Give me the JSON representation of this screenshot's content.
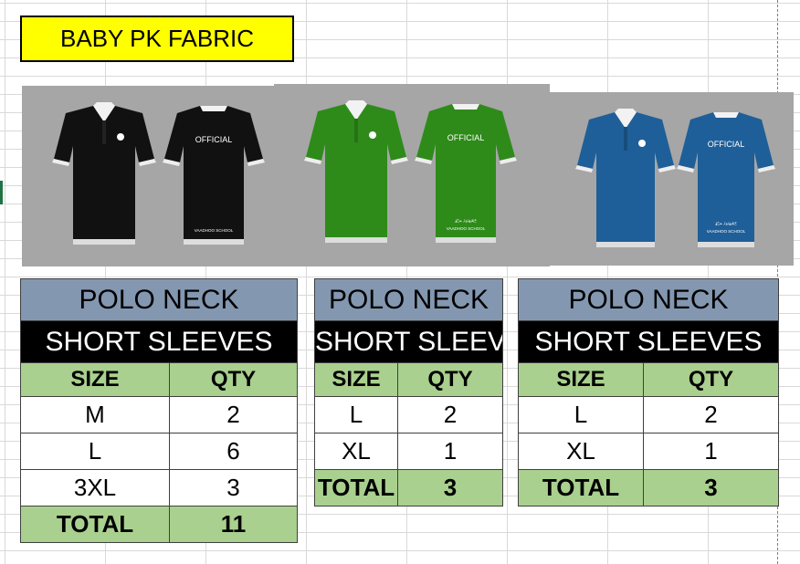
{
  "title": "BABY PK FABRIC",
  "colors": {
    "title_fill": "#ffff00",
    "header_fill": "#8497b0",
    "subheader_fill": "#000000",
    "green_fill": "#a9d08e",
    "shirt_black": "#111111",
    "shirt_green": "#2e8b1a",
    "shirt_blue": "#1e5f99"
  },
  "products": [
    {
      "shirt_color": "black",
      "back_text": "OFFICIAL",
      "back_school_line1": "",
      "back_school_line2": "VAADHOO SCHOOL",
      "neck": "POLO NECK",
      "sleeves": "SHORT SLEEVES",
      "col_size": "SIZE",
      "col_qty": "QTY",
      "rows": [
        {
          "size": "M",
          "qty": "2"
        },
        {
          "size": "L",
          "qty": "6"
        },
        {
          "size": "3XL",
          "qty": "3"
        }
      ],
      "total_label": "TOTAL",
      "total_qty": "11"
    },
    {
      "shirt_color": "green",
      "back_text": "OFFICIAL",
      "back_school_line1": "ބޮޑުންޓަރުވަރު ޝަބޯޓު",
      "back_school_line2": "VAADHOO SCHOOL",
      "neck": "POLO NECK",
      "sleeves": "SHORT SLEEVES",
      "col_size": "SIZE",
      "col_qty": "QTY",
      "rows": [
        {
          "size": "L",
          "qty": "2"
        },
        {
          "size": "XL",
          "qty": "1"
        }
      ],
      "total_label": "TOTAL",
      "total_qty": "3"
    },
    {
      "shirt_color": "blue",
      "back_text": "OFFICIAL",
      "back_school_line1": "ބޮޑުންޓަރުވަރު ޝަބޯޓު",
      "back_school_line2": "VAADHOO SCHOOL",
      "neck": "POLO NECK",
      "sleeves": "SHORT SLEEVES",
      "col_size": "SIZE",
      "col_qty": "QTY",
      "rows": [
        {
          "size": "L",
          "qty": "2"
        },
        {
          "size": "XL",
          "qty": "1"
        }
      ],
      "total_label": "TOTAL",
      "total_qty": "3"
    }
  ]
}
